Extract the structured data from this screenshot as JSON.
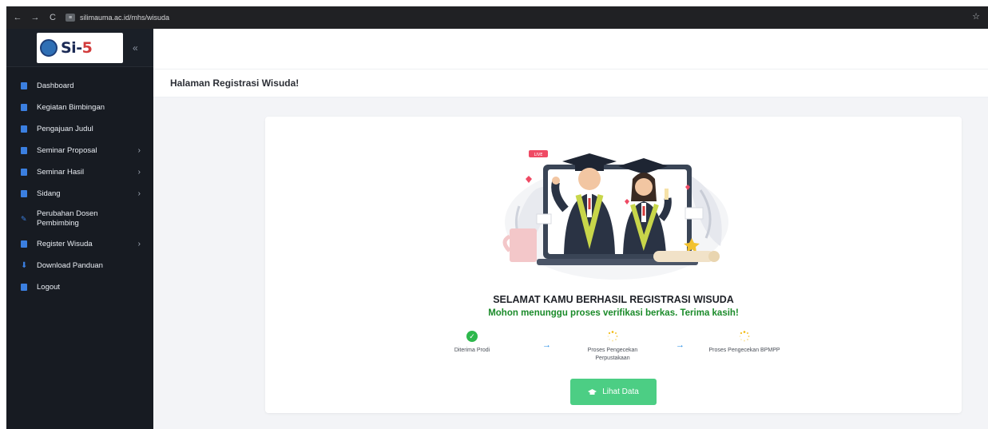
{
  "browser": {
    "url": "silimauma.ac.id/mhs/wisuda",
    "back_icon": "←",
    "forward_icon": "→",
    "reload_icon": "C",
    "bookmark_icon": "☆"
  },
  "sidebar": {
    "logo_text_main": "Si-",
    "logo_text_accent": "5",
    "collapse_icon": "«",
    "items": [
      {
        "label": "Dashboard",
        "icon": "dashboard-icon",
        "has_children": false
      },
      {
        "label": "Kegiatan Bimbingan",
        "icon": "document-icon",
        "has_children": false
      },
      {
        "label": "Pengajuan Judul",
        "icon": "document-icon",
        "has_children": false
      },
      {
        "label": "Seminar Proposal",
        "icon": "document-icon",
        "has_children": true
      },
      {
        "label": "Seminar Hasil",
        "icon": "document-icon",
        "has_children": true
      },
      {
        "label": "Sidang",
        "icon": "document-icon",
        "has_children": true
      },
      {
        "label": "Perubahan Dosen Pembimbing",
        "icon": "pencil-icon",
        "has_children": false
      },
      {
        "label": "Register Wisuda",
        "icon": "document-icon",
        "has_children": true
      },
      {
        "label": "Download Panduan",
        "icon": "download-icon",
        "has_children": false
      },
      {
        "label": "Logout",
        "icon": "logout-icon",
        "has_children": false
      }
    ],
    "chevron": "›"
  },
  "header": {
    "title": "Halaman Registrasi Wisuda!"
  },
  "card": {
    "title": "SELAMAT KAMU BERHASIL REGISTRASI WISUDA",
    "subtitle": "Mohon menunggu proses verifikasi berkas. Terima kasih!",
    "steps": [
      {
        "label": "Diterima Prodi",
        "status": "done"
      },
      {
        "label": "Proses Pengecekan Perpustakaan",
        "status": "pending"
      },
      {
        "label": "Proses Pengecekan BPMPP",
        "status": "pending"
      }
    ],
    "button_label": "Lihat Data"
  },
  "colors": {
    "sidebar_bg": "#171b22",
    "accent_blue": "#3b7fe0",
    "success_green": "#1b8b2a",
    "button_green": "#4cce84",
    "pending_yellow": "#f2b705"
  }
}
